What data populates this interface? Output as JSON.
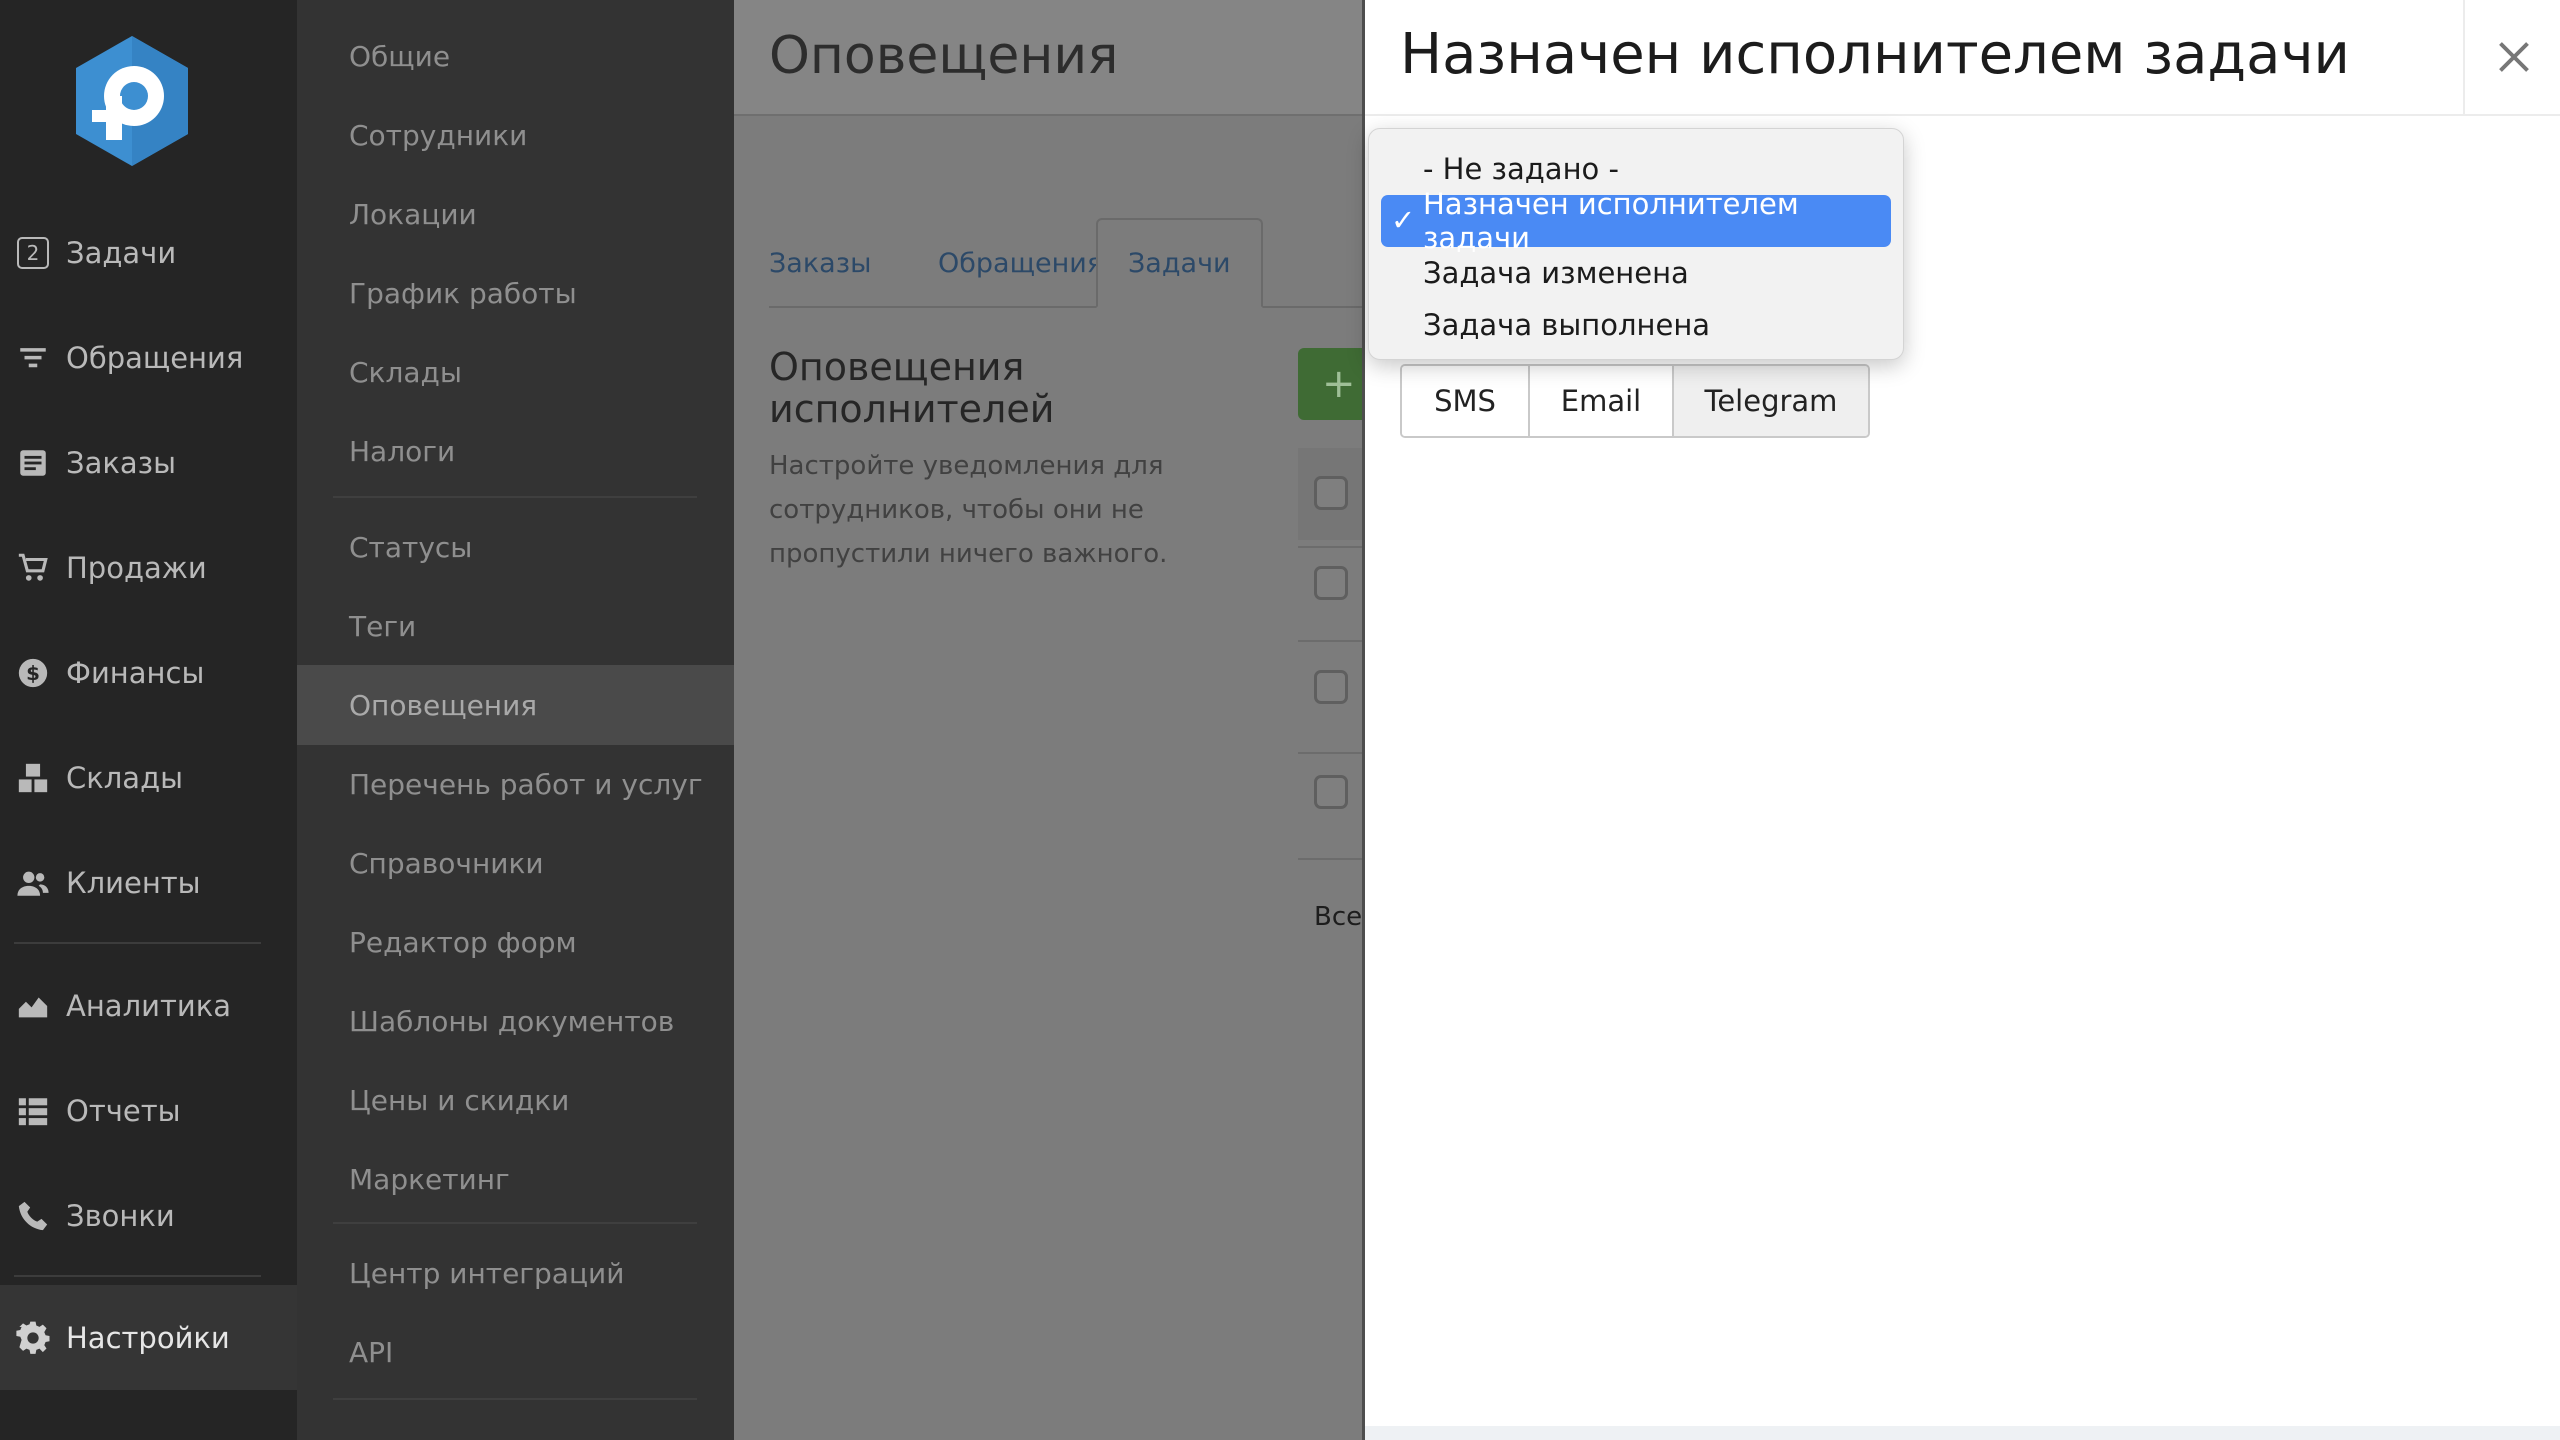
{
  "nav": {
    "items": [
      {
        "label": "Задачи",
        "icon": "tasks-icon",
        "badge": "2"
      },
      {
        "label": "Обращения",
        "icon": "filter-icon"
      },
      {
        "label": "Заказы",
        "icon": "orders-icon"
      },
      {
        "label": "Продажи",
        "icon": "cart-icon"
      },
      {
        "label": "Финансы",
        "icon": "dollar-icon"
      },
      {
        "label": "Склады",
        "icon": "boxes-icon"
      },
      {
        "label": "Клиенты",
        "icon": "users-icon"
      },
      {
        "label": "Аналитика",
        "icon": "area-chart-icon"
      },
      {
        "label": "Отчеты",
        "icon": "table-icon"
      },
      {
        "label": "Звонки",
        "icon": "phone-icon"
      },
      {
        "label": "Настройки",
        "icon": "gear-icon"
      }
    ]
  },
  "submenu": {
    "items": [
      "Общие",
      "Сотрудники",
      "Локации",
      "График работы",
      "Склады",
      "Налоги",
      "Статусы",
      "Теги",
      "Оповещения",
      "Перечень работ и услуг",
      "Справочники",
      "Редактор форм",
      "Шаблоны документов",
      "Цены и скидки",
      "Маркетинг",
      "Центр интеграций",
      "API"
    ]
  },
  "main": {
    "title": "Оповещения",
    "tabs": [
      "Заказы",
      "Обращения",
      "Задачи"
    ],
    "section_title": "Оповещения исполнителей",
    "section_desc": "Настройте уведомления для сотрудников, чтобы они не пропустили ничего важного.",
    "add_label": "+",
    "all_label": "Все"
  },
  "panel": {
    "title": "Назначен исполнителем задачи",
    "close_label": "✕",
    "channels": [
      "SMS",
      "Email",
      "Telegram"
    ]
  },
  "dropdown": {
    "options": [
      "- Не задано -",
      "Назначен исполнителем задачи",
      "Задача изменена",
      "Задача выполнена"
    ],
    "selected": "Назначен исполнителем задачи",
    "check": "✓"
  },
  "colors": {
    "accent": "#4a8af4",
    "nav_bg": "#252525",
    "submenu_bg": "#333333",
    "logo_blue": "#3d8fd1"
  }
}
